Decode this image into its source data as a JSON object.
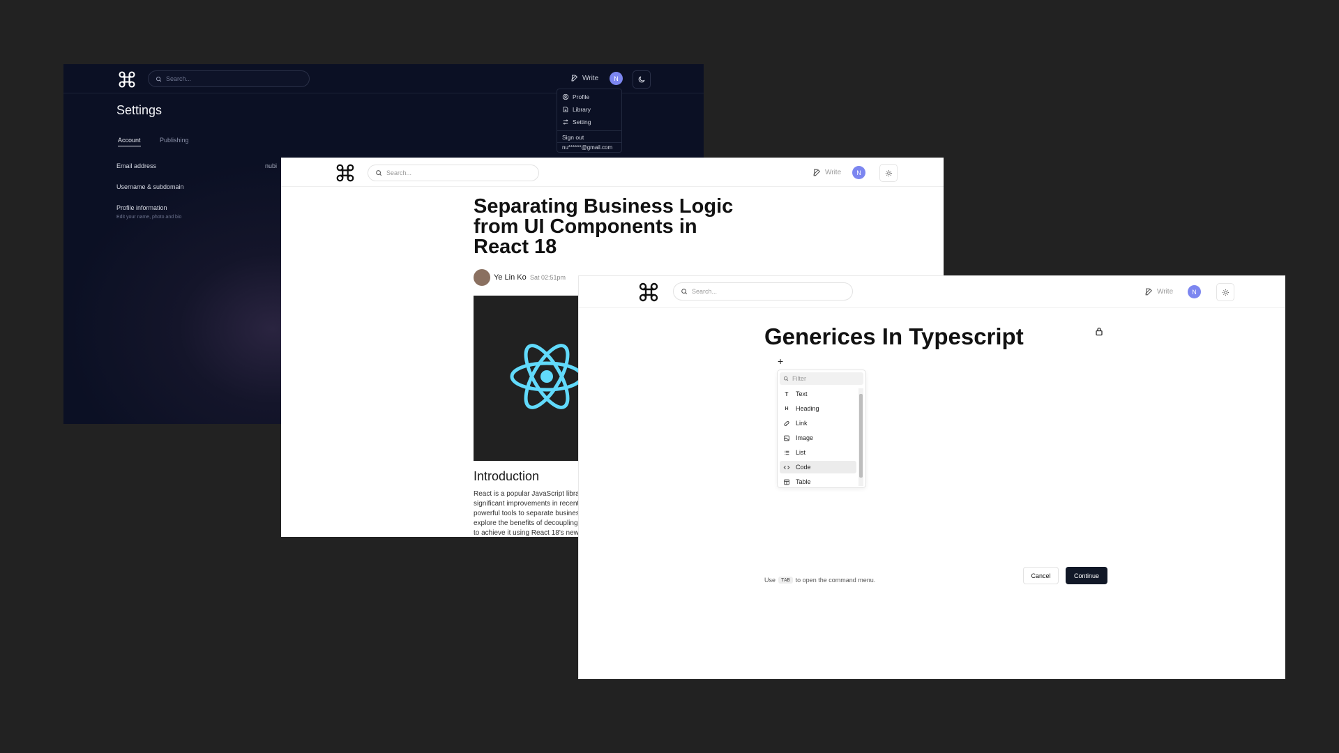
{
  "settings_panel": {
    "search_placeholder": "Search...",
    "write_label": "Write",
    "avatar_initial": "N",
    "title": "Settings",
    "tabs": [
      {
        "label": "Account",
        "active": true
      },
      {
        "label": "Publishing",
        "active": false
      }
    ],
    "rows": {
      "email_label": "Email address",
      "email_value": "nubi",
      "username_label": "Username & subdomain",
      "profile_label": "Profile information",
      "profile_sub": "Edit your name, photo and bio"
    },
    "dropdown": {
      "items": [
        {
          "label": "Profile",
          "icon": "user-circle-icon"
        },
        {
          "label": "Library",
          "icon": "book-icon"
        },
        {
          "label": "Setting",
          "icon": "sliders-icon"
        }
      ],
      "sign_out": "Sign out",
      "email": "nu******@gmail.com"
    }
  },
  "article_panel": {
    "search_placeholder": "Search...",
    "write_label": "Write",
    "avatar_initial": "N",
    "title": "Separating Business Logic from UI Components in React 18",
    "author": "Ye Lin Ko",
    "time": "Sat 02:51pm",
    "intro_heading": "Introduction",
    "intro_text": "React is a popular JavaScript librar significant improvements in recent powerful tools to separate busines explore the benefits of decoupling to achieve it using React 18's new f"
  },
  "editor_panel": {
    "search_placeholder": "Search...",
    "write_label": "Write",
    "avatar_initial": "N",
    "title": "Generices In Typescript",
    "plus": "+",
    "filter_placeholder": "Filter",
    "menu_items": [
      {
        "label": "Text",
        "icon": "T"
      },
      {
        "label": "Heading",
        "icon": "H"
      },
      {
        "label": "Link",
        "icon": "link-icon"
      },
      {
        "label": "Image",
        "icon": "image-icon"
      },
      {
        "label": "List",
        "icon": "list-icon"
      },
      {
        "label": "Code",
        "icon": "code-icon"
      },
      {
        "label": "Table",
        "icon": "table-icon"
      }
    ],
    "selected_item": "Code",
    "hint_prefix": "Use",
    "hint_key": "TAB",
    "hint_suffix": "to open the command menu.",
    "cancel_label": "Cancel",
    "continue_label": "Continue"
  },
  "colors": {
    "background": "#222222",
    "avatar": "#7c86f0",
    "react_logo": "#61dafb",
    "continue_button": "#111827"
  }
}
